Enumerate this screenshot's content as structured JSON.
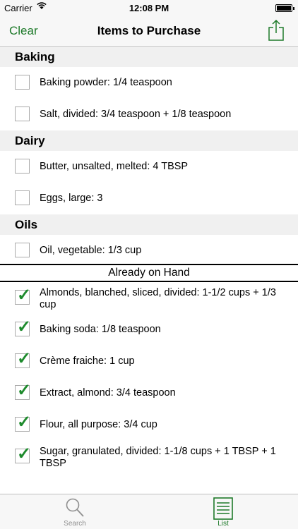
{
  "status": {
    "carrier": "Carrier",
    "time": "12:08 PM"
  },
  "nav": {
    "clear": "Clear",
    "title": "Items to Purchase"
  },
  "sections": [
    {
      "title": "Baking",
      "items": [
        "Baking powder: 1/4 teaspoon",
        "Salt, divided: 3/4 teaspoon + 1/8 teaspoon"
      ]
    },
    {
      "title": "Dairy",
      "items": [
        "Butter, unsalted, melted: 4 TBSP",
        "Eggs, large: 3"
      ]
    },
    {
      "title": "Oils",
      "items": [
        "Oil, vegetable: 1/3 cup"
      ]
    }
  ],
  "on_hand": {
    "title": "Already on Hand",
    "items": [
      "Almonds, blanched, sliced, divided: 1-1/2 cups + 1/3 cup",
      "Baking soda: 1/8 teaspoon",
      "Crème fraiche: 1 cup",
      "Extract, almond: 3/4 teaspoon",
      "Flour, all purpose: 3/4 cup",
      "Sugar, granulated, divided: 1-1/8 cups + 1 TBSP + 1 TBSP"
    ]
  },
  "tabs": {
    "search": "Search",
    "list": "List"
  },
  "colors": {
    "accent": "#1e7a2a",
    "check": "#1d8a2c",
    "section_bg": "#f0f0f0"
  }
}
